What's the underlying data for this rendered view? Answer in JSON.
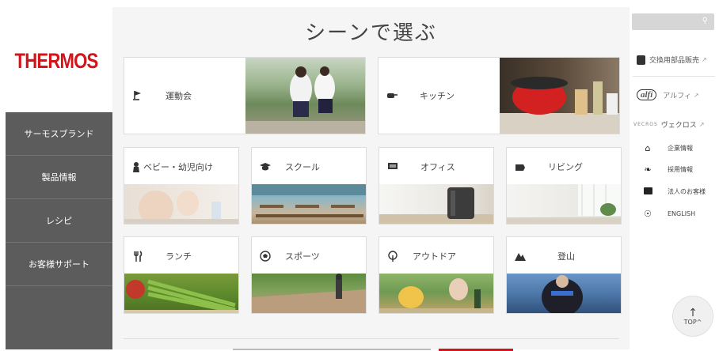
{
  "brand": {
    "logo": "THERMOS"
  },
  "nav": {
    "items": [
      "サーモスブランド",
      "製品情報",
      "レシピ",
      "お客様サポート"
    ]
  },
  "main": {
    "title": "シーンで選ぶ",
    "scenes": [
      {
        "label": "運動会",
        "icon": "flag-icon"
      },
      {
        "label": "キッチン",
        "icon": "pot-icon"
      },
      {
        "label": "ベビー・幼児向け",
        "icon": "baby-icon"
      },
      {
        "label": "スクール",
        "icon": "graduation-cap-icon"
      },
      {
        "label": "オフィス",
        "icon": "monitor-icon"
      },
      {
        "label": "リビング",
        "icon": "sofa-icon"
      },
      {
        "label": "ランチ",
        "icon": "fork-knife-icon"
      },
      {
        "label": "スポーツ",
        "icon": "soccer-ball-icon"
      },
      {
        "label": "アウトドア",
        "icon": "tree-icon"
      },
      {
        "label": "登山",
        "icon": "mountain-icon"
      }
    ]
  },
  "right": {
    "search_placeholder": "",
    "parts_link": "交換用部品販売",
    "alfi_logo": "alfi",
    "alfi_link": "アルフィ",
    "vecros_logo": "VECROS",
    "vecros_link": "ヴェクロス",
    "links": [
      {
        "label": "企業情報",
        "icon": "house-icon"
      },
      {
        "label": "採用情報",
        "icon": "leaf-icon"
      },
      {
        "label": "法人のお客様",
        "icon": "briefcase-icon"
      },
      {
        "label": "ENGLISH",
        "icon": "globe-icon"
      }
    ],
    "top_label": "TOP"
  },
  "colors": {
    "brand_red": "#d3141b",
    "nav_bg": "#5c5c5c",
    "main_bg": "#f5f5f5"
  }
}
